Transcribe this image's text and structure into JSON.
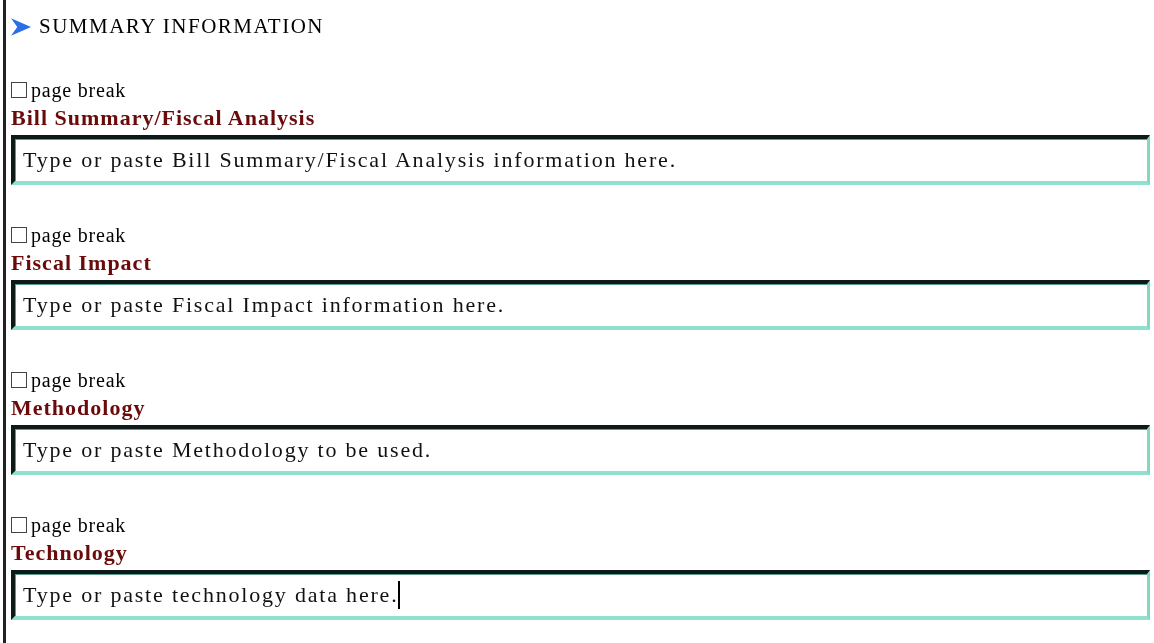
{
  "header": {
    "title": "SUMMARY INFORMATION"
  },
  "sections": [
    {
      "page_break": {
        "label": "page break",
        "checked": false
      },
      "heading": "Bill Summary/Fiscal Analysis",
      "field": {
        "value": "Type or paste Bill Summary/Fiscal Analysis information here.",
        "focused": false
      }
    },
    {
      "page_break": {
        "label": "page break",
        "checked": false
      },
      "heading": "Fiscal Impact",
      "field": {
        "value": "Type or paste Fiscal Impact information here.",
        "focused": false
      }
    },
    {
      "page_break": {
        "label": "page break",
        "checked": false
      },
      "heading": "Methodology",
      "field": {
        "value": "Type or paste Methodology to be used.",
        "focused": false
      }
    },
    {
      "page_break": {
        "label": "page break",
        "checked": false
      },
      "heading": "Technology",
      "field": {
        "value": "Type or paste technology data here.",
        "focused": true
      }
    }
  ]
}
